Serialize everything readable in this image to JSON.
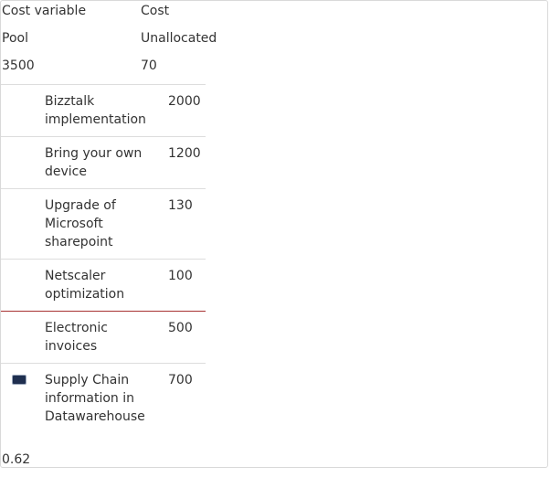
{
  "header": {
    "col1_title": "Cost variable",
    "col2_title": "Cost",
    "pool_label": "Pool",
    "unallocated_label": "Unallocated",
    "pool_value": "3500",
    "unallocated_value": "70"
  },
  "items": [
    {
      "name": "Bizztalk implementation",
      "value": "2000"
    },
    {
      "name": "Bring your own device",
      "value": "1200"
    },
    {
      "name": "Upgrade of Microsoft sharepoint",
      "value": "130"
    },
    {
      "name": "Netscaler optimization",
      "value": "100"
    },
    {
      "name": "Electronic invoices",
      "value": "500"
    },
    {
      "name": "Supply Chain information in Datawarehouse",
      "value": "700",
      "checked": true
    }
  ],
  "footer": {
    "value": "0.62"
  },
  "colors": {
    "highlight_line": "#a83232",
    "checkbox_fill": "#1f2f4f"
  }
}
